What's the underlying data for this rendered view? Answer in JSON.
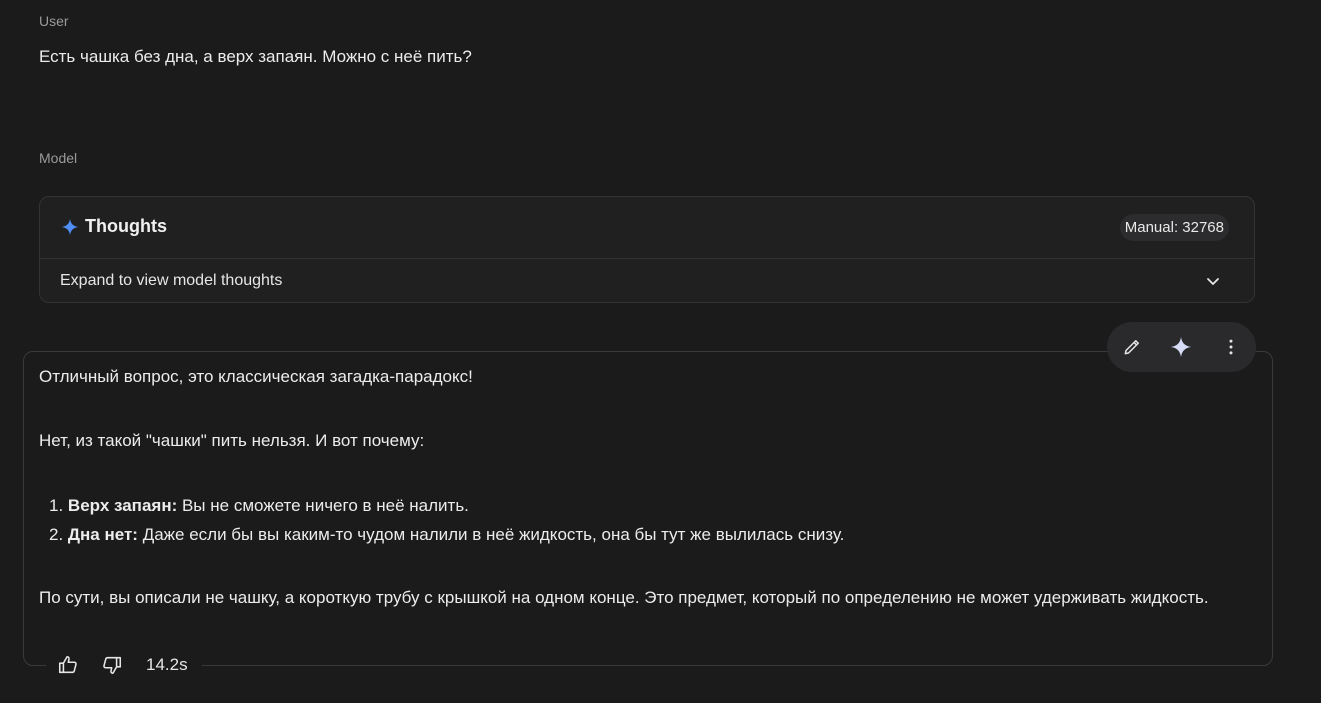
{
  "user": {
    "label": "User",
    "message": "Есть чашка без дна, а верх запаян. Можно с неё пить?"
  },
  "model": {
    "label": "Model",
    "thoughts": {
      "icon": "sparkle-icon",
      "title": "Thoughts",
      "budget_badge": "Manual: 32768",
      "expand_label": "Expand to view model thoughts",
      "accent_color": "#4f8ef7"
    },
    "answer": {
      "intro": "Отличный вопрос, это классическая загадка-парадокс!",
      "lead": "Нет, из такой \"чашки\" пить нельзя. И вот почему:",
      "items": [
        {
          "num": "1.",
          "bold": "Верх запаян:",
          "text": " Вы не сможете ничего в неё налить."
        },
        {
          "num": "2.",
          "bold": "Дна нет:",
          "text": " Даже если бы вы каким-то чудом налили в неё жидкость, она бы тут же вылилась снизу."
        }
      ],
      "conclusion": "По сути, вы описали не чашку, а короткую трубу с крышкой на одном конце. Это предмет, который по определению не может удерживать жидкость."
    },
    "toolbar": {
      "edit_icon": "pencil-icon",
      "rerun_icon": "sparkle-icon",
      "more_icon": "more-vertical-icon"
    },
    "feedback": {
      "like_icon": "thumbs-up-icon",
      "dislike_icon": "thumbs-down-icon",
      "duration": "14.2s"
    }
  }
}
